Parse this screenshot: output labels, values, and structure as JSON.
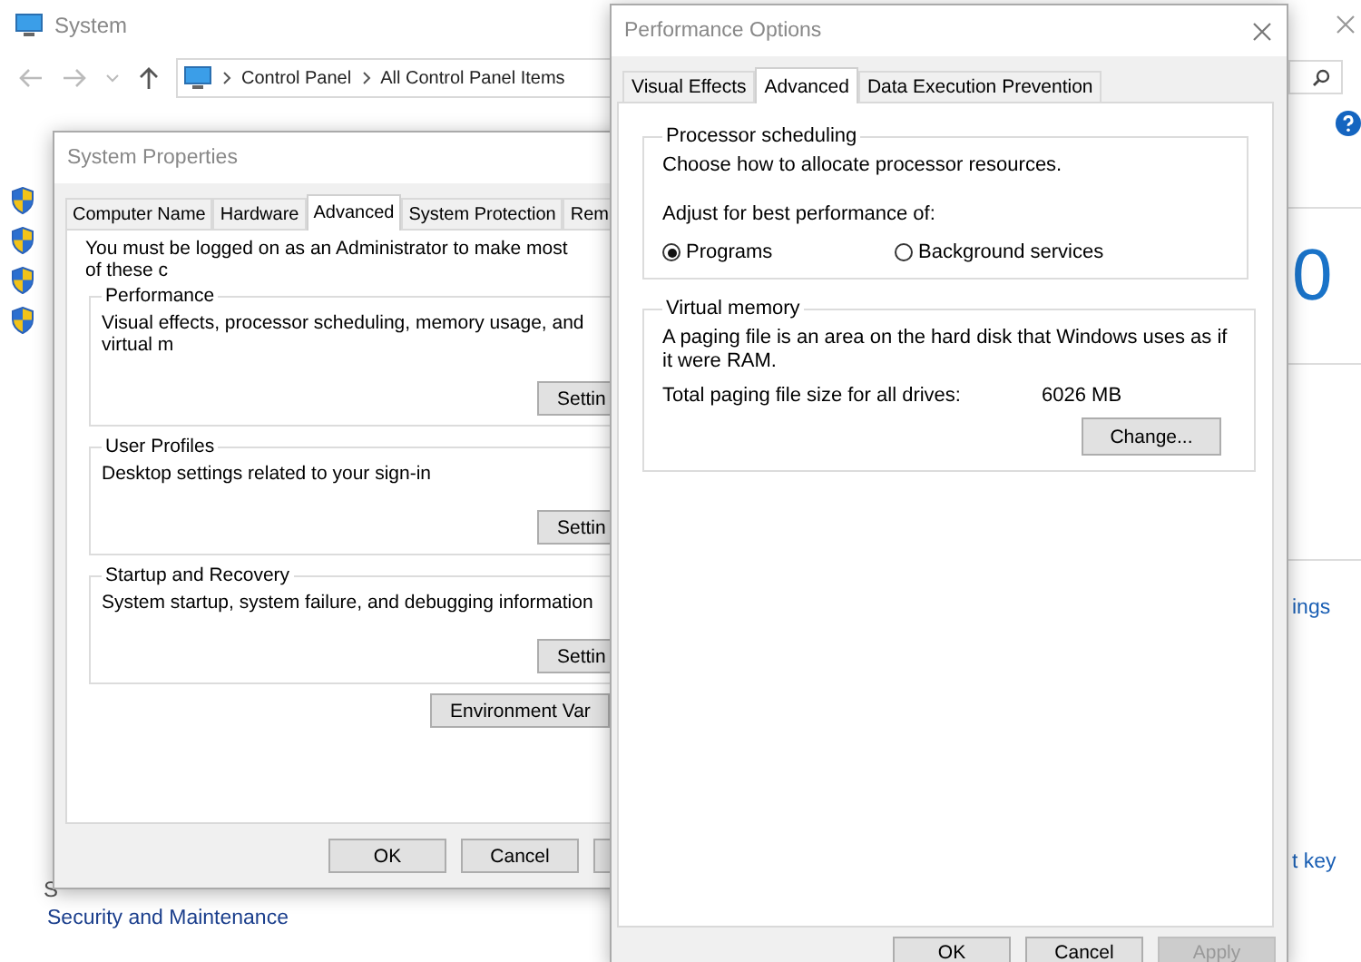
{
  "system_window": {
    "title": "System",
    "breadcrumb": [
      "Control Panel",
      "All Control Panel Items"
    ],
    "big_number": "0",
    "side_links": [
      "ings",
      "t key"
    ],
    "see_also_heading": "S",
    "see_also_links": [
      "Security and Maintenance"
    ]
  },
  "system_properties": {
    "title": "System Properties",
    "tabs": [
      {
        "label": "Computer Name",
        "selected": false
      },
      {
        "label": "Hardware",
        "selected": false
      },
      {
        "label": "Advanced",
        "selected": true
      },
      {
        "label": "System Protection",
        "selected": false
      },
      {
        "label": "Rem",
        "selected": false
      }
    ],
    "notice": "You must be logged on as an Administrator to make most of these c",
    "groups": [
      {
        "title": "Performance",
        "description": "Visual effects, processor scheduling, memory usage, and virtual m",
        "button": "Settin"
      },
      {
        "title": "User Profiles",
        "description": "Desktop settings related to your sign-in",
        "button": "Settin"
      },
      {
        "title": "Startup and Recovery",
        "description": "System startup, system failure, and debugging information",
        "button": "Settin"
      }
    ],
    "environment_button": "Environment Var",
    "buttons": [
      "OK",
      "Cancel"
    ]
  },
  "performance_options": {
    "title": "Performance Options",
    "tabs": [
      {
        "label": "Visual Effects",
        "selected": false
      },
      {
        "label": "Advanced",
        "selected": true
      },
      {
        "label": "Data Execution Prevention",
        "selected": false
      }
    ],
    "processor_scheduling": {
      "title": "Processor scheduling",
      "description": "Choose how to allocate processor resources.",
      "prompt": "Adjust for best performance of:",
      "options": [
        {
          "label": "Programs",
          "selected": true
        },
        {
          "label": "Background services",
          "selected": false
        }
      ]
    },
    "virtual_memory": {
      "title": "Virtual memory",
      "description": "A paging file is an area on the hard disk that Windows uses as if it were RAM.",
      "total_label": "Total paging file size for all drives:",
      "total_value": "6026 MB",
      "button": "Change..."
    },
    "buttons": [
      {
        "label": "OK",
        "disabled": false
      },
      {
        "label": "Cancel",
        "disabled": false
      },
      {
        "label": "Apply",
        "disabled": true
      }
    ]
  }
}
